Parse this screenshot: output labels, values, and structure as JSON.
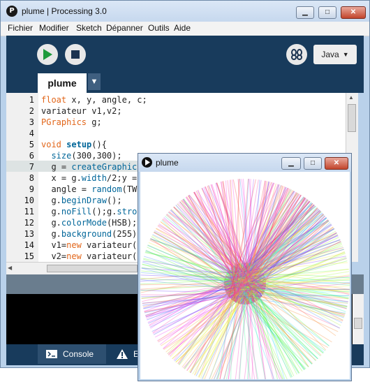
{
  "window": {
    "title": "plume | Processing 3.0"
  },
  "menu": [
    "Fichier",
    "Modifier",
    "Sketch",
    "Dépanner",
    "Outils",
    "Aide"
  ],
  "toolbar": {
    "mode": "Java"
  },
  "tabs": {
    "active": "plume"
  },
  "editor": {
    "line_numbers": [
      "1",
      "2",
      "3",
      "4",
      "5",
      "6",
      "7",
      "8",
      "9",
      "10",
      "11",
      "12",
      "13",
      "14",
      "15"
    ],
    "highlight_line": 7
  },
  "console_tab": {
    "label": "Console"
  },
  "errors_tab": {
    "label": "E"
  },
  "sketch_window": {
    "title": "plume"
  },
  "icons": {
    "app": "processing-logo-icon",
    "run": "play-icon",
    "stop": "stop-icon",
    "debug": "butterfly-icon",
    "console": "console-icon",
    "errors": "warning-icon"
  },
  "colors": {
    "toolbar_bg": "#183b5c",
    "keyword": "#e2661a",
    "function": "#006699",
    "run": "#1e9a3b"
  }
}
